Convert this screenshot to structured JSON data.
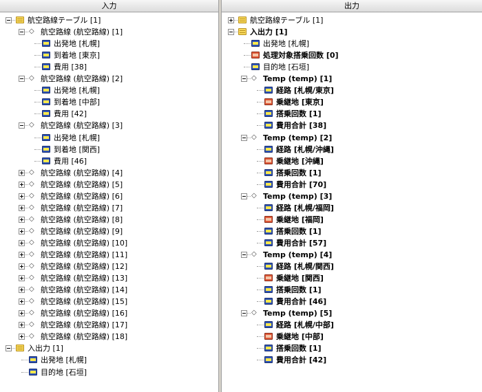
{
  "left_header": "入力",
  "right_header": "出力",
  "left_tree": [
    {
      "d": 0,
      "exp": "minus",
      "icon": "table",
      "label": "航空路線テーブル [1]"
    },
    {
      "d": 1,
      "exp": "minus",
      "icon": "diamond",
      "label": "航空路線 (航空路線) [1]"
    },
    {
      "d": 2,
      "icon": "field",
      "label": "出発地 [札幌]"
    },
    {
      "d": 2,
      "icon": "field",
      "label": "到着地 [東京]"
    },
    {
      "d": 2,
      "icon": "field",
      "label": "費用 [38]"
    },
    {
      "d": 1,
      "exp": "minus",
      "icon": "diamond",
      "label": "航空路線 (航空路線) [2]"
    },
    {
      "d": 2,
      "icon": "field",
      "label": "出発地 [札幌]"
    },
    {
      "d": 2,
      "icon": "field",
      "label": "到着地 [中部]"
    },
    {
      "d": 2,
      "icon": "field",
      "label": "費用 [42]"
    },
    {
      "d": 1,
      "exp": "minus",
      "icon": "diamond",
      "label": "航空路線 (航空路線) [3]"
    },
    {
      "d": 2,
      "icon": "field",
      "label": "出発地 [札幌]"
    },
    {
      "d": 2,
      "icon": "field",
      "label": "到着地 [関西]"
    },
    {
      "d": 2,
      "icon": "field",
      "label": "費用 [46]"
    },
    {
      "d": 1,
      "exp": "plus",
      "icon": "diamond",
      "label": "航空路線 (航空路線) [4]"
    },
    {
      "d": 1,
      "exp": "plus",
      "icon": "diamond",
      "label": "航空路線 (航空路線) [5]"
    },
    {
      "d": 1,
      "exp": "plus",
      "icon": "diamond",
      "label": "航空路線 (航空路線) [6]"
    },
    {
      "d": 1,
      "exp": "plus",
      "icon": "diamond",
      "label": "航空路線 (航空路線) [7]"
    },
    {
      "d": 1,
      "exp": "plus",
      "icon": "diamond",
      "label": "航空路線 (航空路線) [8]"
    },
    {
      "d": 1,
      "exp": "plus",
      "icon": "diamond",
      "label": "航空路線 (航空路線) [9]"
    },
    {
      "d": 1,
      "exp": "plus",
      "icon": "diamond",
      "label": "航空路線 (航空路線) [10]"
    },
    {
      "d": 1,
      "exp": "plus",
      "icon": "diamond",
      "label": "航空路線 (航空路線) [11]"
    },
    {
      "d": 1,
      "exp": "plus",
      "icon": "diamond",
      "label": "航空路線 (航空路線) [12]"
    },
    {
      "d": 1,
      "exp": "plus",
      "icon": "diamond",
      "label": "航空路線 (航空路線) [13]"
    },
    {
      "d": 1,
      "exp": "plus",
      "icon": "diamond",
      "label": "航空路線 (航空路線) [14]"
    },
    {
      "d": 1,
      "exp": "plus",
      "icon": "diamond",
      "label": "航空路線 (航空路線) [15]"
    },
    {
      "d": 1,
      "exp": "plus",
      "icon": "diamond",
      "label": "航空路線 (航空路線) [16]"
    },
    {
      "d": 1,
      "exp": "plus",
      "icon": "diamond",
      "label": "航空路線 (航空路線) [17]"
    },
    {
      "d": 1,
      "exp": "plus",
      "icon": "diamond",
      "label": "航空路線 (航空路線) [18]"
    },
    {
      "d": 0,
      "exp": "minus",
      "icon": "table",
      "label": "入出力 [1]"
    },
    {
      "d": 1,
      "icon": "field",
      "label": "出発地 [札幌]"
    },
    {
      "d": 1,
      "icon": "field",
      "label": "目的地 [石垣]"
    }
  ],
  "right_tree": [
    {
      "d": 0,
      "exp": "plus",
      "icon": "table",
      "label": "航空路線テーブル [1]"
    },
    {
      "d": 0,
      "exp": "minus",
      "icon": "table",
      "label": "入出力 [1]",
      "bold": true
    },
    {
      "d": 1,
      "icon": "field",
      "label": "出発地 [札幌]"
    },
    {
      "d": 1,
      "icon": "red",
      "label": "処理対象搭乗回数 [0]",
      "bold": true
    },
    {
      "d": 1,
      "icon": "field",
      "label": "目的地 [石垣]"
    },
    {
      "d": 1,
      "exp": "minus",
      "icon": "diamond",
      "label": "Temp (temp) [1]",
      "bold": true
    },
    {
      "d": 2,
      "icon": "field",
      "label": "経路 [札幌/東京]",
      "bold": true
    },
    {
      "d": 2,
      "icon": "red",
      "label": "乗継地 [東京]",
      "bold": true
    },
    {
      "d": 2,
      "icon": "field",
      "label": "搭乗回数 [1]",
      "bold": true
    },
    {
      "d": 2,
      "icon": "field",
      "label": "費用合計 [38]",
      "bold": true
    },
    {
      "d": 1,
      "exp": "minus",
      "icon": "diamond",
      "label": "Temp (temp) [2]",
      "bold": true
    },
    {
      "d": 2,
      "icon": "field",
      "label": "経路 [札幌/沖縄]",
      "bold": true
    },
    {
      "d": 2,
      "icon": "red",
      "label": "乗継地 [沖縄]",
      "bold": true
    },
    {
      "d": 2,
      "icon": "field",
      "label": "搭乗回数 [1]",
      "bold": true
    },
    {
      "d": 2,
      "icon": "field",
      "label": "費用合計 [70]",
      "bold": true
    },
    {
      "d": 1,
      "exp": "minus",
      "icon": "diamond",
      "label": "Temp (temp) [3]",
      "bold": true
    },
    {
      "d": 2,
      "icon": "field",
      "label": "経路 [札幌/福岡]",
      "bold": true
    },
    {
      "d": 2,
      "icon": "red",
      "label": "乗継地 [福岡]",
      "bold": true
    },
    {
      "d": 2,
      "icon": "field",
      "label": "搭乗回数 [1]",
      "bold": true
    },
    {
      "d": 2,
      "icon": "field",
      "label": "費用合計 [57]",
      "bold": true
    },
    {
      "d": 1,
      "exp": "minus",
      "icon": "diamond",
      "label": "Temp (temp) [4]",
      "bold": true
    },
    {
      "d": 2,
      "icon": "field",
      "label": "経路 [札幌/関西]",
      "bold": true
    },
    {
      "d": 2,
      "icon": "red",
      "label": "乗継地 [関西]",
      "bold": true
    },
    {
      "d": 2,
      "icon": "field",
      "label": "搭乗回数 [1]",
      "bold": true
    },
    {
      "d": 2,
      "icon": "field",
      "label": "費用合計 [46]",
      "bold": true
    },
    {
      "d": 1,
      "exp": "minus",
      "icon": "diamond",
      "label": "Temp (temp) [5]",
      "bold": true
    },
    {
      "d": 2,
      "icon": "field",
      "label": "経路 [札幌/中部]",
      "bold": true
    },
    {
      "d": 2,
      "icon": "red",
      "label": "乗継地 [中部]",
      "bold": true
    },
    {
      "d": 2,
      "icon": "field",
      "label": "搭乗回数 [1]",
      "bold": true
    },
    {
      "d": 2,
      "icon": "field",
      "label": "費用合計 [42]",
      "bold": true
    }
  ]
}
